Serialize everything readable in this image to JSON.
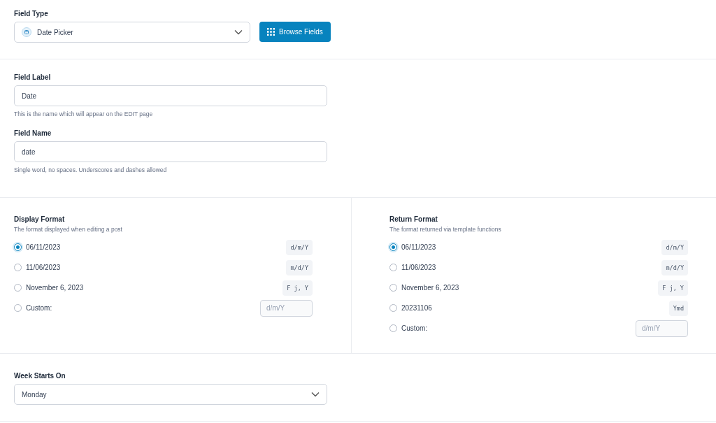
{
  "field_type": {
    "label": "Field Type",
    "value": "Date Picker",
    "button": "Browse Fields"
  },
  "field_label": {
    "label": "Field Label",
    "value": "Date",
    "help": "This is the name which will appear on the EDIT page"
  },
  "field_name": {
    "label": "Field Name",
    "value": "date",
    "help": "Single word, no spaces. Underscores and dashes allowed"
  },
  "formats": [
    {
      "title": "Display Format",
      "description": "The format displayed when editing a post",
      "options": [
        {
          "kind": "preset",
          "label": "06/11/2023",
          "code": "d/m/Y",
          "selected": true
        },
        {
          "kind": "preset",
          "label": "11/06/2023",
          "code": "m/d/Y",
          "selected": false
        },
        {
          "kind": "preset",
          "label": "November 6, 2023",
          "code": "F j, Y",
          "selected": false
        },
        {
          "kind": "custom",
          "label": "Custom:",
          "placeholder": "d/m/Y",
          "selected": false
        }
      ]
    },
    {
      "title": "Return Format",
      "description": "The format returned via template functions",
      "options": [
        {
          "kind": "preset",
          "label": "06/11/2023",
          "code": "d/m/Y",
          "selected": true
        },
        {
          "kind": "preset",
          "label": "11/06/2023",
          "code": "m/d/Y",
          "selected": false
        },
        {
          "kind": "preset",
          "label": "November 6, 2023",
          "code": "F j, Y",
          "selected": false
        },
        {
          "kind": "preset",
          "label": "20231106",
          "code": "Ymd",
          "selected": false
        },
        {
          "kind": "custom",
          "label": "Custom:",
          "placeholder": "d/m/Y",
          "selected": false
        }
      ]
    }
  ],
  "week_starts_on": {
    "label": "Week Starts On",
    "value": "Monday"
  }
}
